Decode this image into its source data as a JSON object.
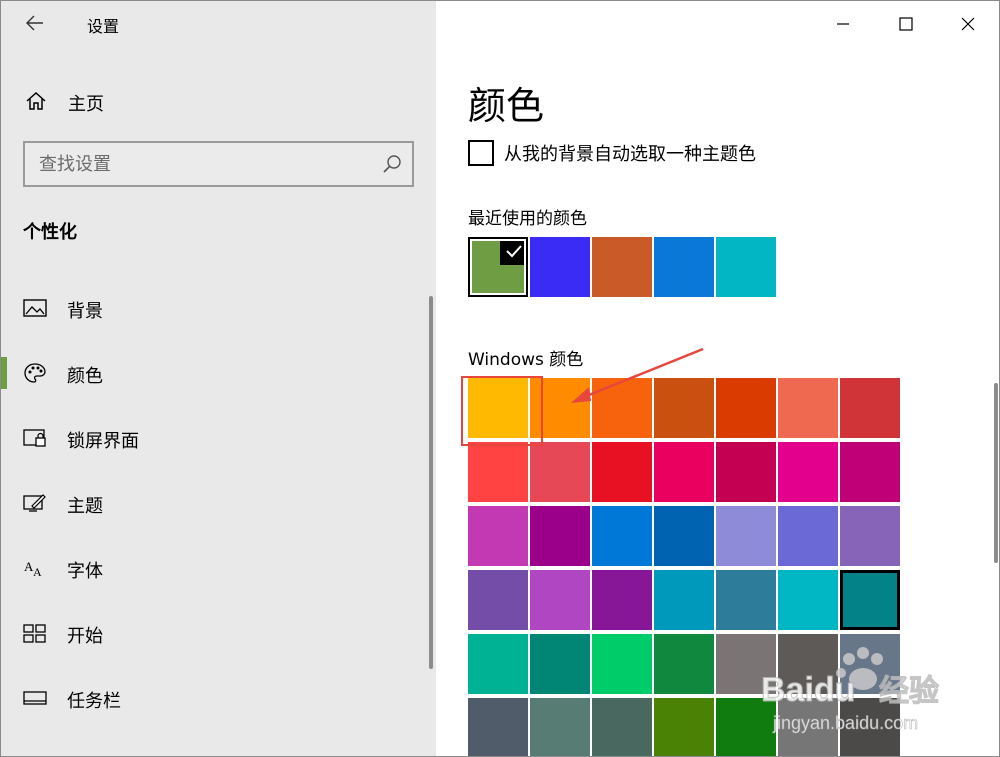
{
  "app": {
    "title": "设置"
  },
  "sidebar": {
    "home_label": "主页",
    "search_placeholder": "查找设置",
    "section_heading": "个性化",
    "items": [
      {
        "label": "背景",
        "icon": "picture-icon"
      },
      {
        "label": "颜色",
        "icon": "palette-icon",
        "active": true
      },
      {
        "label": "锁屏界面",
        "icon": "lock-screen-icon"
      },
      {
        "label": "主题",
        "icon": "theme-icon"
      },
      {
        "label": "字体",
        "icon": "font-icon"
      },
      {
        "label": "开始",
        "icon": "start-icon"
      },
      {
        "label": "任务栏",
        "icon": "taskbar-icon"
      }
    ],
    "accent_color": "#6f9d44"
  },
  "main": {
    "title": "颜色",
    "auto_pick_label": "从我的背景自动选取一种主题色",
    "recent_heading": "最近使用的颜色",
    "recent_colors": [
      "#6f9d44",
      "#3a2bf5",
      "#ca5a28",
      "#0a78d7",
      "#02b6c4"
    ],
    "windows_heading": "Windows 颜色",
    "windows_colors": [
      [
        "#ffb900",
        "#ff8c00",
        "#f7630c",
        "#ca5010",
        "#da3b01",
        "#ef6950",
        "#d13438"
      ],
      [
        "#ff4343",
        "#e74856",
        "#e81123",
        "#ea005e",
        "#c30052",
        "#e3008c",
        "#bf0077"
      ],
      [
        "#c239b3",
        "#9a0089",
        "#0078d7",
        "#0063b1",
        "#8e8cd8",
        "#6b69d6",
        "#8764b8"
      ],
      [
        "#744da9",
        "#b146c2",
        "#881798",
        "#0099bc",
        "#2d7d9a",
        "#00b7c3",
        "#038387"
      ],
      [
        "#00b294",
        "#018574",
        "#00cc6a",
        "#10893e",
        "#7a7574",
        "#5d5a58",
        "#68768a"
      ],
      [
        "#515c6b",
        "#567c73",
        "#486860",
        "#498205",
        "#107c10",
        "#767676",
        "#4c4a48"
      ]
    ],
    "selected_windows_color": "#038387"
  },
  "watermark": {
    "brand": "Baidu",
    "cn": "经验",
    "url": "jingyan.baidu.com"
  }
}
